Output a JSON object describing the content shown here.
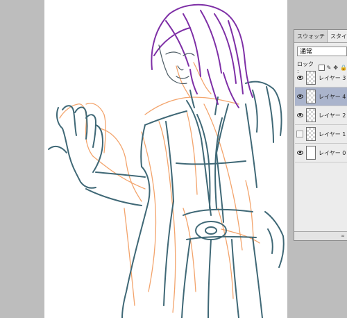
{
  "panel": {
    "tabs": [
      "スウォッチ",
      "スタイル"
    ],
    "blend_mode": "通常",
    "lock_label": "ロック :",
    "lock_icons": [
      "transparency-lock-icon",
      "brush-lock-icon",
      "move-lock-icon",
      "padlock-icon"
    ],
    "layers": [
      {
        "name": "レイヤー 3",
        "visible": true,
        "selected": false,
        "thumb": "transparent"
      },
      {
        "name": "レイヤー 4",
        "visible": true,
        "selected": true,
        "thumb": "transparent"
      },
      {
        "name": "レイヤー 2",
        "visible": true,
        "selected": false,
        "thumb": "transparent"
      },
      {
        "name": "レイヤー 1",
        "visible": false,
        "selected": false,
        "thumb": "transparent"
      },
      {
        "name": "レイヤー 0",
        "visible": true,
        "selected": false,
        "thumb": "white"
      }
    ],
    "link_icon": "link-icon"
  },
  "colors": {
    "workspace": "#bdbdbd",
    "canvas": "#ffffff",
    "hair_stroke": "#7e2fa6",
    "body_stroke": "#3f6876",
    "underdraw_stroke": "#f3a46c",
    "selected_layer": "#aab4cc"
  }
}
